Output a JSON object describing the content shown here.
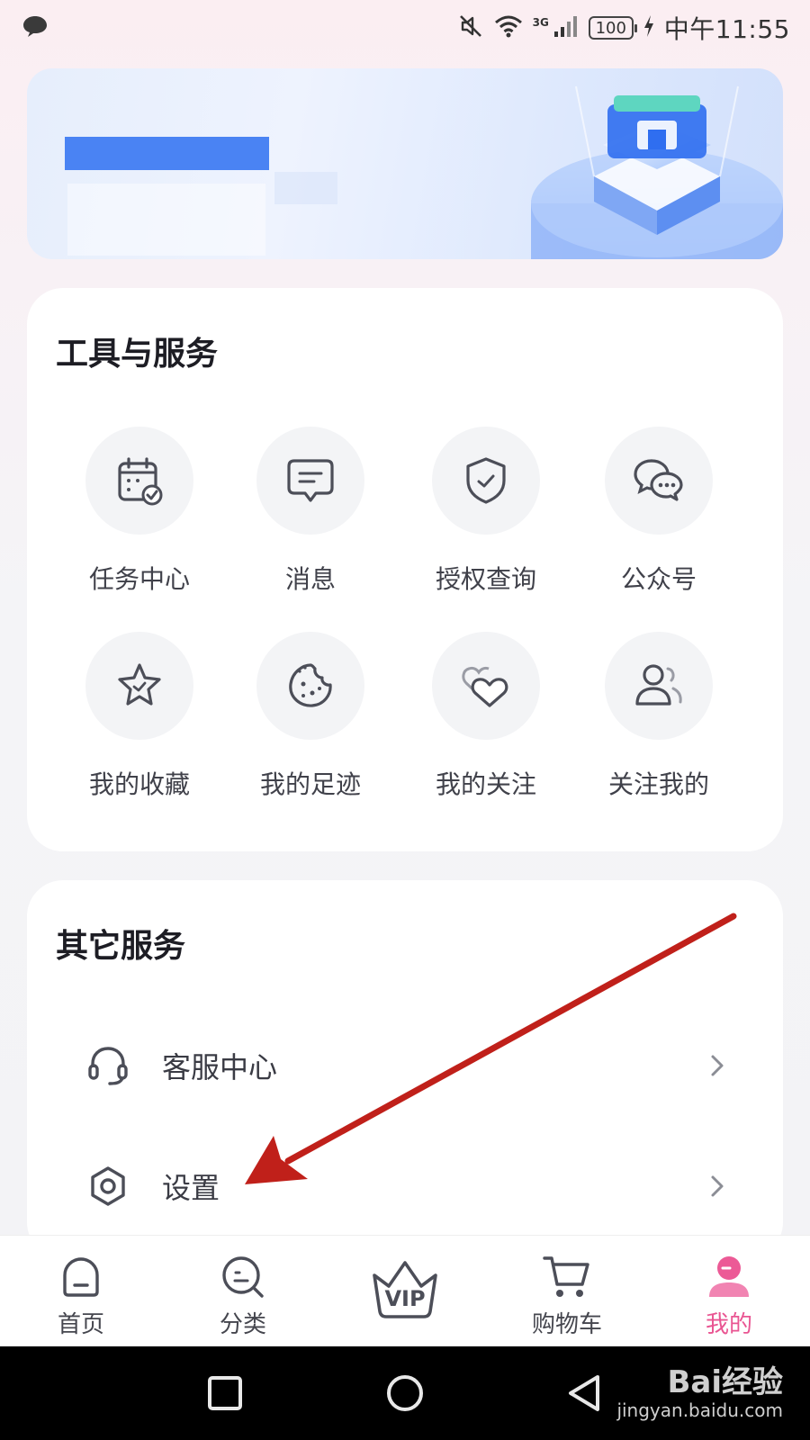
{
  "status_bar": {
    "time": "中午11:55",
    "battery": "100",
    "network": "3G"
  },
  "banner": {
    "icon": "storefront-illustration"
  },
  "tools_section": {
    "title": "工具与服务",
    "items": [
      {
        "label": "任务中心",
        "icon": "calendar-check-icon"
      },
      {
        "label": "消息",
        "icon": "message-icon"
      },
      {
        "label": "授权查询",
        "icon": "shield-check-icon"
      },
      {
        "label": "公众号",
        "icon": "wechat-icon"
      },
      {
        "label": "我的收藏",
        "icon": "star-icon"
      },
      {
        "label": "我的足迹",
        "icon": "cookie-icon"
      },
      {
        "label": "我的关注",
        "icon": "hearts-icon"
      },
      {
        "label": "关注我的",
        "icon": "followers-icon"
      }
    ]
  },
  "other_section": {
    "title": "其它服务",
    "items": [
      {
        "label": "客服中心",
        "icon": "headset-icon"
      },
      {
        "label": "设置",
        "icon": "settings-hexagon-icon"
      }
    ]
  },
  "tab_bar": {
    "tabs": [
      {
        "label": "首页",
        "icon": "home-icon"
      },
      {
        "label": "分类",
        "icon": "category-icon"
      },
      {
        "label": "",
        "icon": "vip-crown-icon"
      },
      {
        "label": "购物车",
        "icon": "cart-icon"
      },
      {
        "label": "我的",
        "icon": "profile-icon",
        "active": true
      }
    ],
    "active_color": "#e95592"
  },
  "watermark": {
    "main": "Bai经验",
    "sub": "jingyan.baidu.com"
  },
  "colors": {
    "accent_pink": "#e95592",
    "banner_blue": "#4a83f3",
    "annotation_arrow": "#c0201a"
  }
}
